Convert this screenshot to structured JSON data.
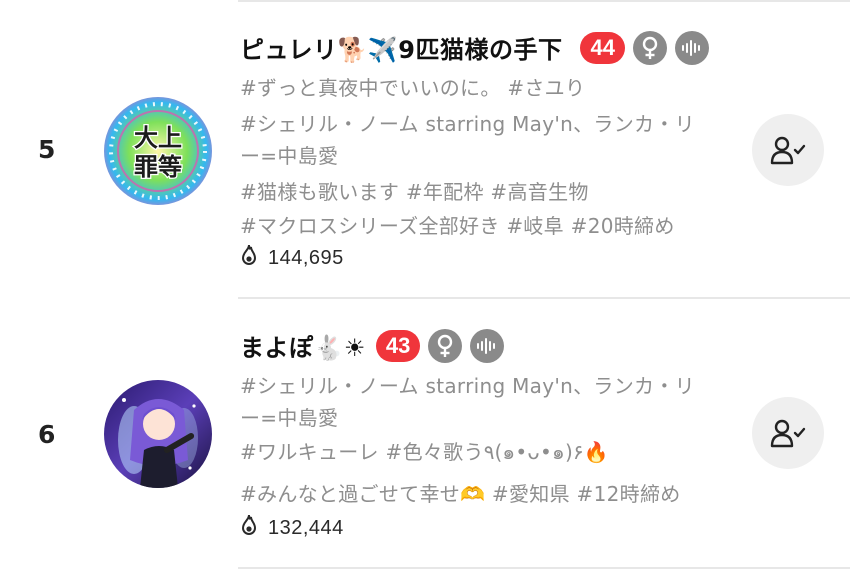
{
  "entries": [
    {
      "rank": "5",
      "name": "ピュレリ🐕✈️9匹猫様の手下",
      "level": "44",
      "tag_lines": [
        "#ずっと真夜中でいいのに。 #さユり",
        "#シェリル・ノーム starring May'n、ランカ・リ",
        "ー=中島愛",
        "#猫様も歌います #年配枠 #高音生物",
        "#マクロスシリーズ全部好き #岐阜 #20時締め"
      ],
      "heat": "144,695",
      "avatar_text": [
        "大上",
        "罪等"
      ],
      "gender_icon": "female-icon",
      "voice_icon": "voice-wave-icon",
      "follow_icon": "user-check-icon"
    },
    {
      "rank": "6",
      "name": "まよぽ🐇☀",
      "level": "43",
      "tag_lines": [
        "#シェリル・ノーム starring May'n、ランカ・リ",
        "ー=中島愛",
        "#ワルキューレ #色々歌う٩(๑•ᴗ•๑)۶🔥",
        "#みんなと過ごせて幸せ🫶 #愛知県 #12時締め"
      ],
      "heat": "132,444",
      "gender_icon": "female-icon",
      "voice_icon": "voice-wave-icon",
      "follow_icon": "user-check-icon"
    }
  ],
  "colors": {
    "level_badge": "#f0353b",
    "icon_circle": "#8a8a8a",
    "tag_text": "#8e8e8e",
    "follow_bg": "#efefef"
  }
}
